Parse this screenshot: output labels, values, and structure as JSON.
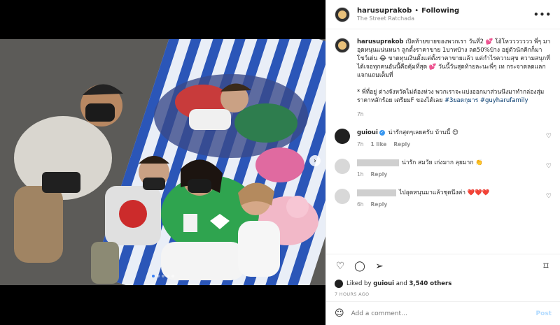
{
  "post": {
    "username": "harusuprakob",
    "separator": "•",
    "follow_status": "Following",
    "location": "The Street Ratchada",
    "more_icon": "more-horizontal-icon"
  },
  "caption": {
    "username": "harusuprakob",
    "text": "เปิดท้ายขายของพวกเรา วันที่2 💕 โอ้โหววววววว พี่ๆ มาอุดหนุนแน่นหนา ลูกตั้งราคาขาย 1บาทบ้าง ลด50%บ้าง อยู่ตัวนักคิกก็มาโชว์เด่น 😂 ขาดทุนเงินตั้งแต่ตั้งราคาขายแล้ว แต่กำไรความสุข ความสนุกที่ได้เจอทุกคนอันนี้คือคุ้มที่สุด 💕 วันนี้วันสุดท้ายละนะพี่ๆ เท กระจาดลดแลกแจกแถมเต็มที่",
    "note": "* พี่ที่อยู่ ต่างจังหวัดไม่ต้องห่วง พวกเราจะแบ่งออกมาส่วนนึงมาทำกล่องสุ่มราคาหลักร้อย เตรียมF ของได้เลย ",
    "hashtag_1": "#3ยอดกุมาร",
    "hashtag_2": "#guyharufamily",
    "time": "7h"
  },
  "comments": [
    {
      "username": "guioui",
      "verified": "✓",
      "text": "น่ารักสุดๆเลยครับ บ้านนี้ 😍",
      "time": "7h",
      "likes": "1 like",
      "reply": "Reply"
    },
    {
      "username": "",
      "text": "น่ารัก สมวัย เก่งมาก ลุยมาก 👏",
      "time": "1h",
      "reply": "Reply"
    },
    {
      "username": "",
      "text": "ไปอุดหนุนมาแล้วชุดนึงค่า ❤️❤️❤️",
      "time": "6h",
      "reply": "Reply"
    }
  ],
  "actions": {
    "like_icon": "heart-icon",
    "comment_icon": "comment-icon",
    "share_icon": "share-icon",
    "save_icon": "bookmark-icon"
  },
  "likes": {
    "prefix": "Liked by",
    "user": "guioui",
    "and": "and",
    "others": "3,540 others"
  },
  "time_ago": "7 HOURS AGO",
  "add_comment": {
    "placeholder": "Add a comment…",
    "post_label": "Post",
    "emoji_icon": "emoji-icon"
  },
  "colors": {
    "link": "#00376b",
    "verified": "#3897f0",
    "post_disabled": "#b3dbff"
  }
}
